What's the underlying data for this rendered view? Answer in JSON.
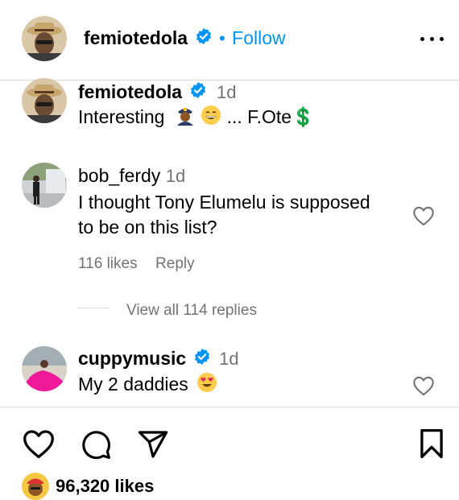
{
  "header": {
    "username": "femiotedola",
    "separator": "•",
    "follow_label": "Follow"
  },
  "caption": {
    "username": "femiotedola",
    "time": "1d",
    "text": "Interesting",
    "text_tail": "... F.Ote",
    "dollar_emoji": "💲"
  },
  "comments": [
    {
      "username": "bob_ferdy",
      "time": "1d",
      "line1": "I thought Tony Elumelu is supposed",
      "line2": "to be on this list?",
      "likes": "116 likes",
      "reply_label": "Reply",
      "view_replies": "View all 114 replies"
    },
    {
      "username": "cuppymusic",
      "time": "1d",
      "text": "My 2 daddies"
    }
  ],
  "footer": {
    "likes_count": "96,320 likes"
  },
  "icons": {
    "verified": "verified-badge-icon",
    "more": "more-options-icon",
    "heart": "heart-icon",
    "comment": "comment-icon",
    "share": "share-icon",
    "save": "bookmark-icon"
  },
  "colors": {
    "accent": "#0095f6",
    "muted": "#737373",
    "divider": "#dbdbdb"
  }
}
